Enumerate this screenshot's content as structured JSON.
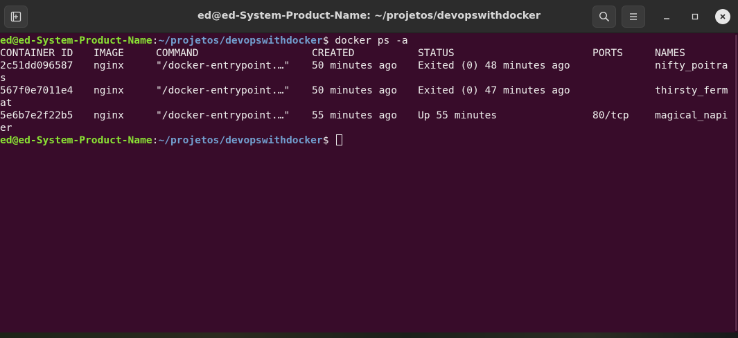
{
  "window": {
    "title": "ed@ed-System-Product-Name: ~/projetos/devopswithdocker"
  },
  "titlebar": {
    "icons": {
      "new_tab": "new-tab-icon",
      "search": "search-icon",
      "menu": "hamburger-menu-icon",
      "minimize": "minimize-icon",
      "maximize": "maximize-icon",
      "close": "close-icon"
    }
  },
  "colors": {
    "terminal_bg": "#380c2a",
    "terminal_fg": "#eeeeec",
    "prompt_user": "#8ae234",
    "prompt_path": "#729fcf",
    "titlebar_bg": "#2c2c2c"
  },
  "prompt": {
    "user_host": "ed@ed-System-Product-Name",
    "colon": ":",
    "path": "~/projetos/devopswithdocker",
    "symbol": "$ "
  },
  "command": "docker ps -a",
  "table": {
    "headers": [
      "CONTAINER ID",
      "IMAGE",
      "COMMAND",
      "CREATED",
      "STATUS",
      "PORTS",
      "NAMES"
    ],
    "rows": [
      {
        "cells": [
          "2c51dd096587",
          "nginx",
          "\"/docker-entrypoint.…\"",
          "50 minutes ago",
          "Exited (0) 48 minutes ago",
          "",
          "nifty_poitra"
        ],
        "wrap": "s"
      },
      {
        "cells": [
          "567f0e7011e4",
          "nginx",
          "\"/docker-entrypoint.…\"",
          "50 minutes ago",
          "Exited (0) 47 minutes ago",
          "",
          "thirsty_ferm"
        ],
        "wrap": "at"
      },
      {
        "cells": [
          "5e6b7e2f22b5",
          "nginx",
          "\"/docker-entrypoint.…\"",
          "55 minutes ago",
          "Up 55 minutes",
          "80/tcp",
          "magical_napi"
        ],
        "wrap": "er"
      }
    ]
  }
}
